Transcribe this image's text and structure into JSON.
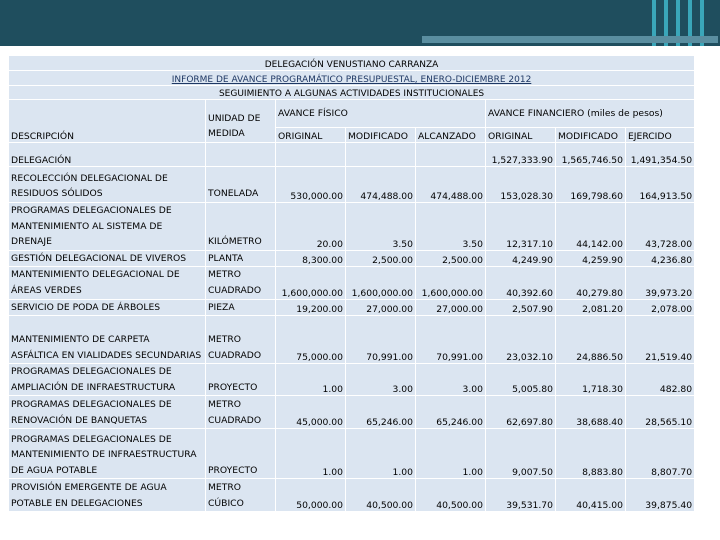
{
  "header": {
    "title1": "DELEGACIÓN VENUSTIANO CARRANZA",
    "title2": "INFORME DE AVANCE PROGRAMÁTICO PRESUPUESTAL, ENERO-DICIEMBRE 2012",
    "title3": "SEGUIMIENTO A ALGUNAS ACTIVIDADES INSTITUCIONALES"
  },
  "columns": {
    "descripcion": "DESCRIPCIÓN",
    "unidad": [
      "UNIDAD DE",
      "MEDIDA"
    ],
    "avance_fisico": "AVANCE FÍSICO",
    "avance_financiero": "AVANCE FINANCIERO (miles de pesos)",
    "original": "ORIGINAL",
    "modificado": "MODIFICADO",
    "alcanzado": "ALCANZADO",
    "original2": "ORIGINAL",
    "modificado2": "MODIFICADO",
    "ejercido": "EJERCIDO"
  },
  "delegacion": {
    "label": "DELEGACIÓN",
    "original": "1,527,333.90",
    "modificado": "1,565,746.50",
    "ejercido": "1,491,354.50"
  },
  "rows": [
    {
      "desc": [
        "RECOLECCIÓN DELEGACIONAL DE",
        "RESIDUOS SÓLIDOS"
      ],
      "unidad": [
        "TONELADA"
      ],
      "orig": "530,000.00",
      "mod": "474,488.00",
      "alc": "474,488.00",
      "forig": "153,028.30",
      "fmod": "169,798.60",
      "fej": "164,913.50"
    },
    {
      "desc": [
        "PROGRAMAS DELEGACIONALES DE",
        "MANTENIMIENTO AL SISTEMA DE",
        "DRENAJE"
      ],
      "unidad": [
        "KILÓMETRO"
      ],
      "orig": "20.00",
      "mod": "3.50",
      "alc": "3.50",
      "forig": "12,317.10",
      "fmod": "44,142.00",
      "fej": "43,728.00"
    },
    {
      "desc": [
        "GESTIÓN DELEGACIONAL DE VIVEROS"
      ],
      "unidad": [
        "PLANTA"
      ],
      "orig": "8,300.00",
      "mod": "2,500.00",
      "alc": "2,500.00",
      "forig": "4,249.90",
      "fmod": "4,259.90",
      "fej": "4,236.80"
    },
    {
      "desc": [
        "MANTENIMIENTO DELEGACIONAL DE",
        "ÁREAS VERDES"
      ],
      "unidad": [
        "METRO",
        "CUADRADO"
      ],
      "orig": "1,600,000.00",
      "mod": "1,600,000.00",
      "alc": "1,600,000.00",
      "forig": "40,392.60",
      "fmod": "40,279.80",
      "fej": "39,973.20"
    },
    {
      "desc": [
        "SERVICIO DE PODA DE ÁRBOLES"
      ],
      "unidad": [
        "PIEZA"
      ],
      "orig": "19,200.00",
      "mod": "27,000.00",
      "alc": "27,000.00",
      "forig": "2,507.90",
      "fmod": "2,081.20",
      "fej": "2,078.00"
    },
    {
      "desc": [
        "MANTENIMIENTO DE CARPETA",
        "ASFÁLTICA EN VIALIDADES SECUNDARIAS"
      ],
      "unidad": [
        "METRO",
        "CUADRADO"
      ],
      "orig": "75,000.00",
      "mod": "70,991.00",
      "alc": "70,991.00",
      "forig": "23,032.10",
      "fmod": "24,886.50",
      "fej": "21,519.40"
    },
    {
      "desc": [
        "PROGRAMAS DELEGACIONALES DE",
        "AMPLIACIÓN DE INFRAESTRUCTURA"
      ],
      "unidad": [
        "PROYECTO"
      ],
      "orig": "1.00",
      "mod": "3.00",
      "alc": "3.00",
      "forig": "5,005.80",
      "fmod": "1,718.30",
      "fej": "482.80"
    },
    {
      "desc": [
        "PROGRAMAS DELEGACIONALES DE",
        "RENOVACIÓN DE BANQUETAS"
      ],
      "unidad": [
        "METRO",
        "CUADRADO"
      ],
      "orig": "45,000.00",
      "mod": "65,246.00",
      "alc": "65,246.00",
      "forig": "62,697.80",
      "fmod": "38,688.40",
      "fej": "28,565.10"
    },
    {
      "desc": [
        "PROGRAMAS DELEGACIONALES DE",
        "MANTENIMIENTO DE INFRAESTRUCTURA",
        "DE AGUA POTABLE"
      ],
      "unidad": [
        "PROYECTO"
      ],
      "orig": "1.00",
      "mod": "1.00",
      "alc": "1.00",
      "forig": "9,007.50",
      "fmod": "8,883.80",
      "fej": "8,807.70"
    },
    {
      "desc": [
        "PROVISIÓN EMERGENTE DE AGUA",
        "POTABLE EN DELEGACIONES"
      ],
      "unidad": [
        "METRO",
        "CÚBICO"
      ],
      "orig": "50,000.00",
      "mod": "40,500.00",
      "alc": "40,500.00",
      "forig": "39,531.70",
      "fmod": "40,415.00",
      "fej": "39,875.40"
    }
  ]
}
